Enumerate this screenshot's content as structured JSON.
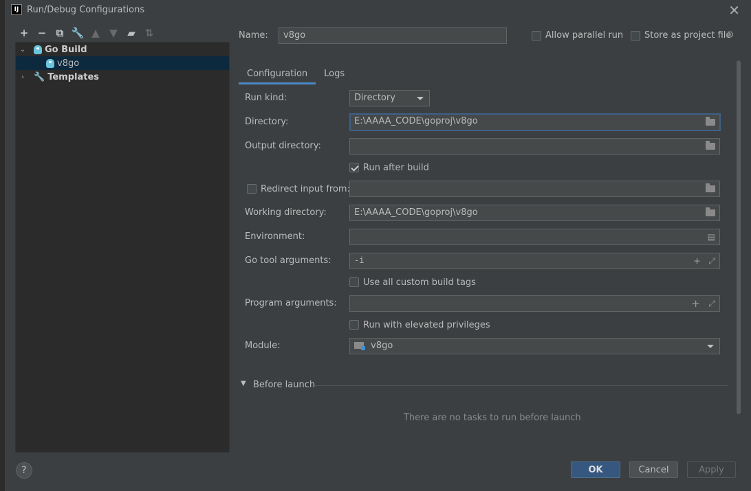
{
  "window": {
    "title": "Run/Debug Configurations",
    "app_icon": "IJ"
  },
  "tree": {
    "group": "Go Build",
    "item": "v8go",
    "templates": "Templates"
  },
  "form": {
    "name_label": "Name:",
    "name_value": "v8go",
    "allow_parallel": "Allow parallel run",
    "store_project": "Store as project file",
    "tabs": [
      "Configuration",
      "Logs"
    ],
    "run_kind_label": "Run kind:",
    "run_kind_value": "Directory",
    "directory_label": "Directory:",
    "directory_value": "E:\\AAAA_CODE\\goproj\\v8go",
    "output_label": "Output directory:",
    "output_value": "",
    "run_after_build": "Run after build",
    "redirect_label": "Redirect input from:",
    "working_label": "Working directory:",
    "working_value": "E:\\AAAA_CODE\\goproj\\v8go",
    "env_label": "Environment:",
    "go_tool_label": "Go tool arguments:",
    "go_tool_value": "-i",
    "custom_tags": "Use all custom build tags",
    "program_label": "Program arguments:",
    "elevated": "Run with elevated privileges",
    "module_label": "Module:",
    "module_value": "v8go",
    "before_launch": "Before launch",
    "no_tasks": "There are no tasks to run before launch"
  },
  "buttons": {
    "ok": "OK",
    "cancel": "Cancel",
    "apply": "Apply",
    "help": "?"
  },
  "toolbar": {
    "add": "+",
    "remove": "−"
  },
  "colors": {
    "background": "#3c3f41",
    "field": "#45494a",
    "accent": "#365880",
    "focus": "#3d6185"
  }
}
